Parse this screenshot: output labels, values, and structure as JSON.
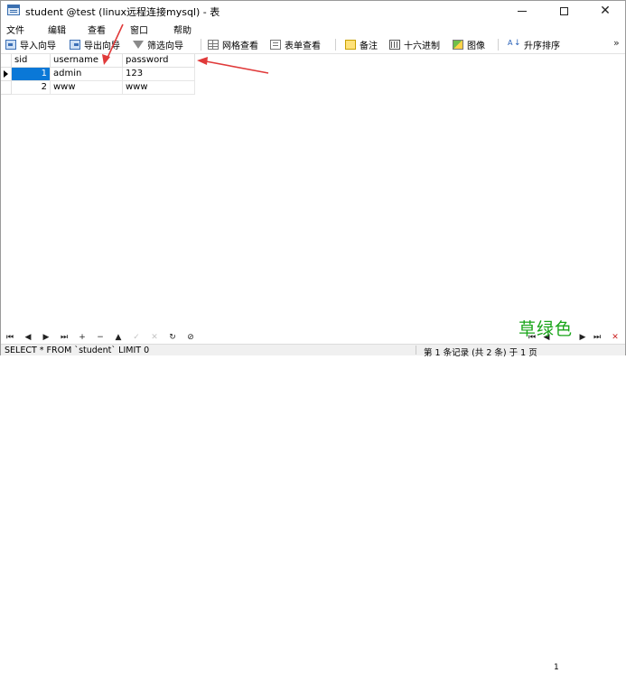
{
  "window": {
    "title": "student @test (linux远程连接mysql) - 表",
    "controls": {
      "minimize": "—",
      "maximize": "□",
      "close": "✕"
    }
  },
  "menu": [
    "文件",
    "编辑",
    "查看",
    "窗口",
    "帮助"
  ],
  "toolbar": {
    "import_wizard": "导入向导",
    "export_wizard": "导出向导",
    "filter_wizard": "筛选向导",
    "grid_view": "网格查看",
    "form_view": "表单查看",
    "memo": "备注",
    "hex": "十六进制",
    "image": "图像",
    "sort": "升序排序",
    "more": "»"
  },
  "table": {
    "columns": [
      "sid",
      "username",
      "password"
    ],
    "rows": [
      [
        "1",
        "admin",
        "123"
      ],
      [
        "2",
        "www",
        "www"
      ]
    ]
  },
  "navigator": {
    "page_value": "1",
    "buttons": [
      "first",
      "prev",
      "next",
      "last",
      "add",
      "delete",
      "up",
      "apply",
      "cancel",
      "refresh",
      "stop"
    ]
  },
  "watermark": "草绿色",
  "status": {
    "sql": "SELECT * FROM `student` LIMIT 0",
    "records": "第 1 条记录 (共 2 条) 于 1 页"
  },
  "colors": {
    "selection": "#0a78d7",
    "annotation": "#e03a3a",
    "watermark": "#1aa51a"
  }
}
